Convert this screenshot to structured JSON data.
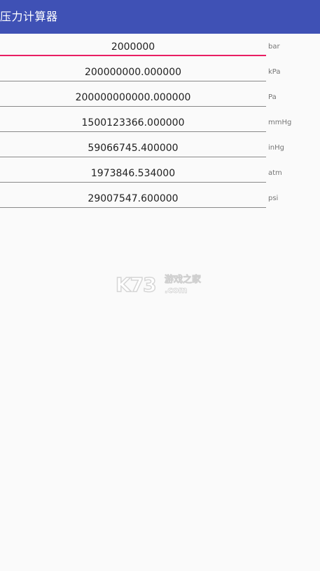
{
  "app_bar": {
    "title": "压力计算器",
    "color": "#3f51b5"
  },
  "fields": [
    {
      "value": "2000000",
      "unit": "bar",
      "focused": true
    },
    {
      "value": "200000000.000000",
      "unit": "kPa",
      "focused": false
    },
    {
      "value": "200000000000.000000",
      "unit": "Pa",
      "focused": false
    },
    {
      "value": "1500123366.000000",
      "unit": "mmHg",
      "focused": false
    },
    {
      "value": "59066745.400000",
      "unit": "inHg",
      "focused": false
    },
    {
      "value": "1973846.534000",
      "unit": "atm",
      "focused": false
    },
    {
      "value": "29007547.600000",
      "unit": "psi",
      "focused": false
    }
  ],
  "watermark": {
    "brand": "K73",
    "tagline": "游戏之家",
    "domain": ".com"
  },
  "colors": {
    "focus_underline": "#e91e63",
    "underline": "#8a8a8a",
    "background": "#fafafa"
  }
}
